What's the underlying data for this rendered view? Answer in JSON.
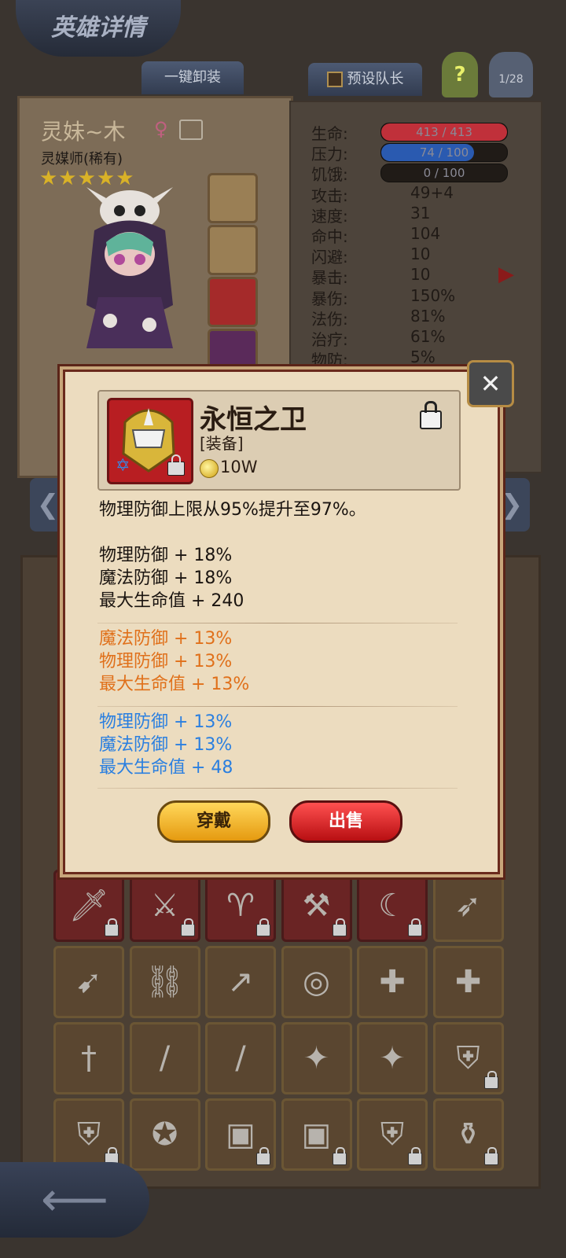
{
  "screen": {
    "title": "英雄详情",
    "unequip_all_label": "一键卸装",
    "preset_captain_label": "预设队长",
    "help_label": "?",
    "page_indicator": "1/28"
  },
  "hero": {
    "name": "灵妹~木",
    "class": "灵媒师(稀有)",
    "stars": "★★★★★",
    "gender_icon": "female-icon"
  },
  "stats": [
    {
      "label": "生命:",
      "bar_text": "413 / 413",
      "fill": 1.0,
      "color": "#c0303a"
    },
    {
      "label": "压力:",
      "bar_text": "74 / 100",
      "fill": 0.74,
      "color": "#2a5ab0"
    },
    {
      "label": "饥饿:",
      "bar_text": "0 / 100",
      "fill": 0.0,
      "color": "#555555"
    },
    {
      "label": "攻击:",
      "value": "49+4"
    },
    {
      "label": "速度:",
      "value": "31"
    },
    {
      "label": "命中:",
      "value": "104"
    },
    {
      "label": "闪避:",
      "value": "10"
    },
    {
      "label": "暴击:",
      "value": "10"
    },
    {
      "label": "暴伤:",
      "value": "150%"
    },
    {
      "label": "法伤:",
      "value": "81%"
    },
    {
      "label": "治疗:",
      "value": "61%"
    },
    {
      "label": "物防:",
      "value": "5%"
    }
  ],
  "item": {
    "name": "永恒之卫",
    "type": "[装备]",
    "price": "10W",
    "description": "物理防御上限从95%提升至97%。",
    "base_stats": [
      "物理防御 + 18%",
      "魔法防御 + 18%",
      "最大生命值 + 240"
    ],
    "orange_stats": [
      "魔法防御 + 13%",
      "物理防御 + 13%",
      "最大生命值 + 13%"
    ],
    "blue_stats": [
      "物理防御 + 13%",
      "魔法防御 + 13%",
      "最大生命值 + 48"
    ]
  },
  "actions": {
    "equip_label": "穿戴",
    "sell_label": "出售"
  },
  "colors": {
    "orange_stat": "#e0701a",
    "blue_stat": "#2a7fe0",
    "equip_button": "#f5b82a",
    "sell_button": "#d81e22"
  },
  "inventory": [
    {
      "icon": "red-dagger-icon",
      "locked": true
    },
    {
      "icon": "ornate-sword-icon",
      "locked": true
    },
    {
      "icon": "horn-icon",
      "locked": true
    },
    {
      "icon": "axe-icon",
      "locked": true
    },
    {
      "icon": "claw-icon",
      "locked": true
    },
    {
      "icon": "crossbow-icon",
      "locked": false
    },
    {
      "icon": "bow-icon",
      "locked": false
    },
    {
      "icon": "chain-whip-icon",
      "locked": false
    },
    {
      "icon": "spear-icon",
      "locked": false
    },
    {
      "icon": "ruby-ring-icon",
      "locked": false
    },
    {
      "icon": "medkit-icon",
      "locked": false
    },
    {
      "icon": "medkit-icon",
      "locked": false
    },
    {
      "icon": "short-sword-icon",
      "locked": false
    },
    {
      "icon": "staff-icon",
      "locked": false
    },
    {
      "icon": "staff-icon",
      "locked": false
    },
    {
      "icon": "blue-spear-icon",
      "locked": false
    },
    {
      "icon": "blue-spear-icon",
      "locked": false
    },
    {
      "icon": "shield-icon",
      "locked": true
    },
    {
      "icon": "shield-icon",
      "locked": true
    },
    {
      "icon": "amulet-icon",
      "locked": false
    },
    {
      "icon": "chest-armor-icon",
      "locked": true
    },
    {
      "icon": "chest-armor-icon",
      "locked": true
    },
    {
      "icon": "shield-icon",
      "locked": true
    },
    {
      "icon": "potion-flask-icon",
      "locked": true
    }
  ]
}
